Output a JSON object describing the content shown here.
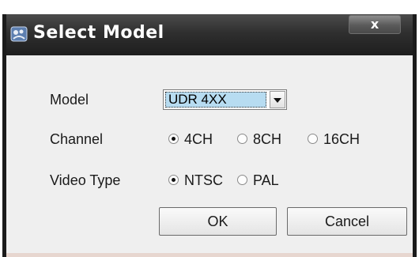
{
  "window": {
    "title": "Select Model",
    "close_glyph": "x",
    "icon": "app-icon"
  },
  "form": {
    "model": {
      "label": "Model",
      "selected": "UDR 4XX"
    },
    "channel": {
      "label": "Channel",
      "options": [
        "4CH",
        "8CH",
        "16CH"
      ],
      "selected": "4CH"
    },
    "video_type": {
      "label": "Video Type",
      "options": [
        "NTSC",
        "PAL"
      ],
      "selected": "NTSC"
    }
  },
  "buttons": {
    "ok": "OK",
    "cancel": "Cancel"
  }
}
